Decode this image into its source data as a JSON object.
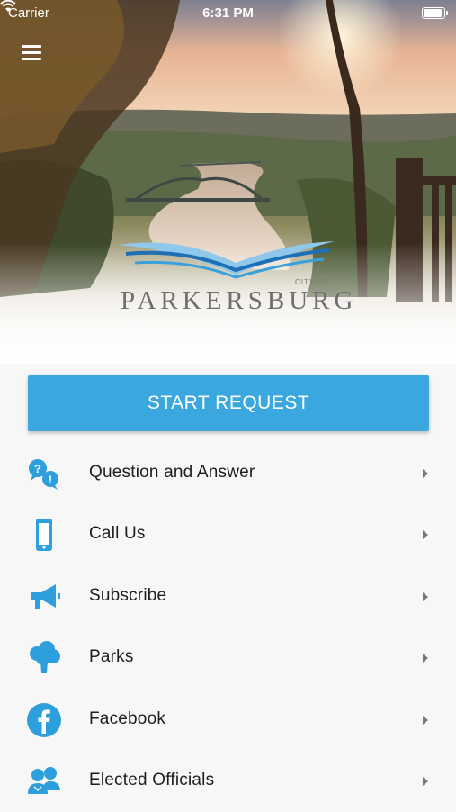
{
  "status_bar": {
    "carrier": "Carrier",
    "time": "6:31 PM",
    "battery_level": 1.0
  },
  "header": {
    "menu_icon": "hamburger-menu-icon",
    "logo": {
      "city_of": "CITY OF",
      "name": "PARKERSBURG"
    }
  },
  "start_request": {
    "label": "START REQUEST",
    "color": "#3aa7df"
  },
  "menu": {
    "icon_color": "#2d9fdc",
    "items": [
      {
        "label": "Question and Answer",
        "icon": "chat-bubbles-icon"
      },
      {
        "label": "Call Us",
        "icon": "phone-icon"
      },
      {
        "label": "Subscribe",
        "icon": "megaphone-icon"
      },
      {
        "label": "Parks",
        "icon": "tree-icon"
      },
      {
        "label": "Facebook",
        "icon": "facebook-icon"
      },
      {
        "label": "Elected Officials",
        "icon": "officials-icon"
      }
    ]
  }
}
